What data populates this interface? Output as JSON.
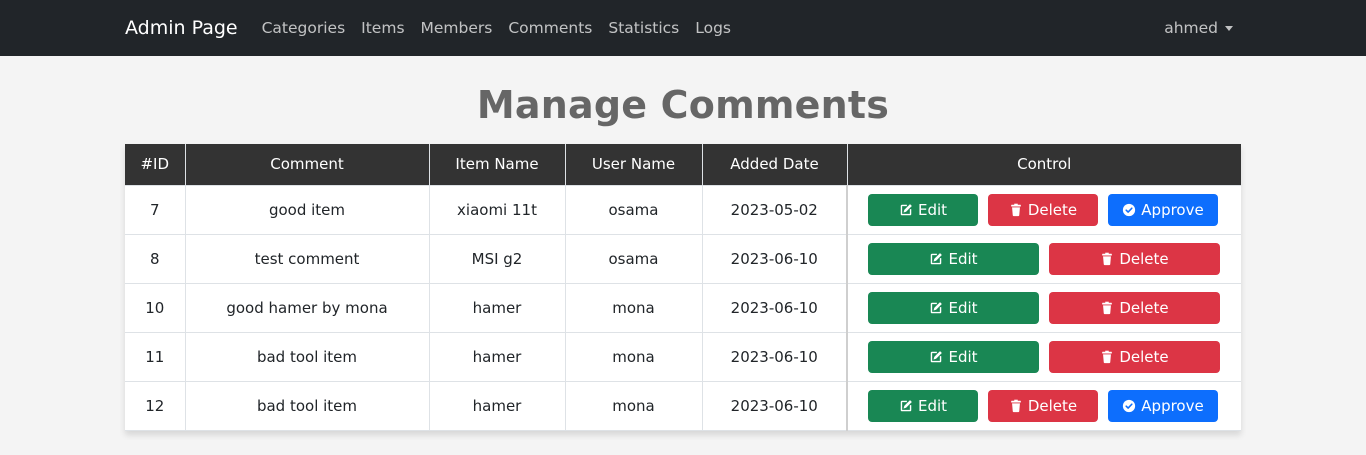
{
  "navbar": {
    "brand": "Admin Page",
    "links": [
      "Categories",
      "Items",
      "Members",
      "Comments",
      "Statistics",
      "Logs"
    ],
    "user": "ahmed"
  },
  "page": {
    "title": "Manage Comments"
  },
  "table": {
    "headers": [
      "#ID",
      "Comment",
      "Item Name",
      "User Name",
      "Added Date",
      "Control"
    ],
    "rows": [
      {
        "id": "7",
        "comment": "good item",
        "item": "xiaomi 11t",
        "user": "osama",
        "date": "2023-05-02",
        "approve": true
      },
      {
        "id": "8",
        "comment": "test comment",
        "item": "MSI g2",
        "user": "osama",
        "date": "2023-06-10",
        "approve": false
      },
      {
        "id": "10",
        "comment": "good hamer by mona",
        "item": "hamer",
        "user": "mona",
        "date": "2023-06-10",
        "approve": false
      },
      {
        "id": "11",
        "comment": "bad tool item",
        "item": "hamer",
        "user": "mona",
        "date": "2023-06-10",
        "approve": false
      },
      {
        "id": "12",
        "comment": "bad tool item",
        "item": "hamer",
        "user": "mona",
        "date": "2023-06-10",
        "approve": true
      }
    ],
    "buttons": {
      "edit": "Edit",
      "delete": "Delete",
      "approve": "Approve"
    },
    "icons": {
      "edit": "edit-icon",
      "delete": "trash-icon",
      "approve": "check-circle-icon"
    }
  },
  "colors": {
    "navbar_bg": "#212529",
    "header_bg": "#333333",
    "edit": "#198754",
    "delete": "#dc3545",
    "approve": "#0d6efd"
  }
}
